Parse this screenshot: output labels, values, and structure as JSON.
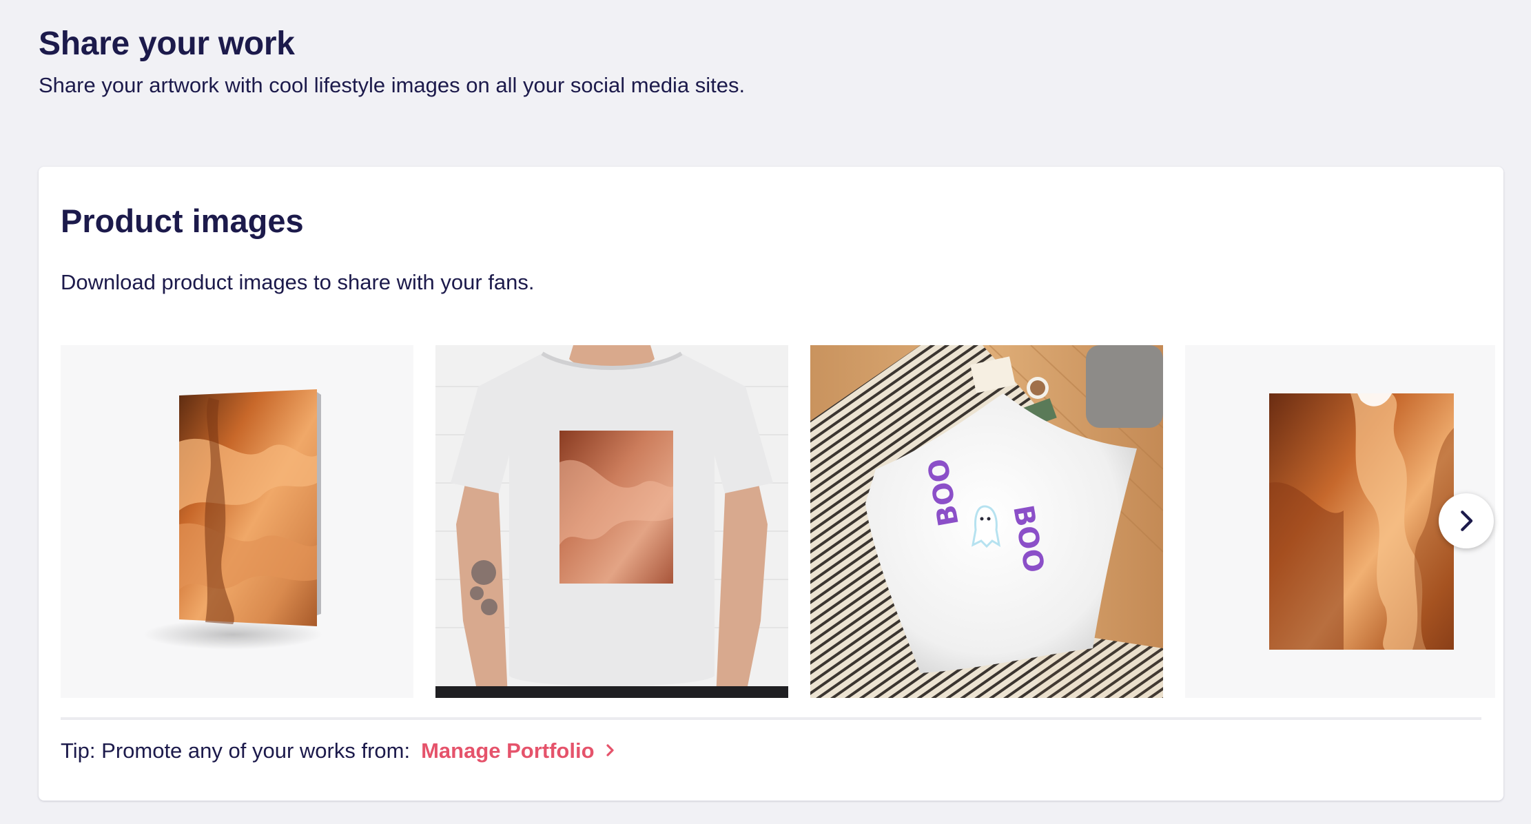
{
  "header": {
    "title": "Share your work",
    "subtitle": "Share your artwork with cool lifestyle images on all your social media sites."
  },
  "product_images": {
    "title": "Product images",
    "description": "Download product images to share with your fans.",
    "items": [
      {
        "name": "greeting-card",
        "alt": "Greeting card with canyon artwork"
      },
      {
        "name": "classic-t-shirt",
        "alt": "White t-shirt with canyon artwork"
      },
      {
        "name": "floor-pillow",
        "alt": "White floor pillow with BOO ghost design"
      },
      {
        "name": "art-print",
        "alt": "Art print with canyon artwork"
      }
    ],
    "next_button_icon": "chevron-right-icon"
  },
  "tip": {
    "text": "Tip: Promote any of your works from:",
    "link_label": "Manage Portfolio",
    "link_icon": "chevron-right-icon"
  },
  "colors": {
    "background": "#f1f1f5",
    "heading": "#1c1a4b",
    "accent": "#e5536b",
    "card": "#ffffff"
  }
}
